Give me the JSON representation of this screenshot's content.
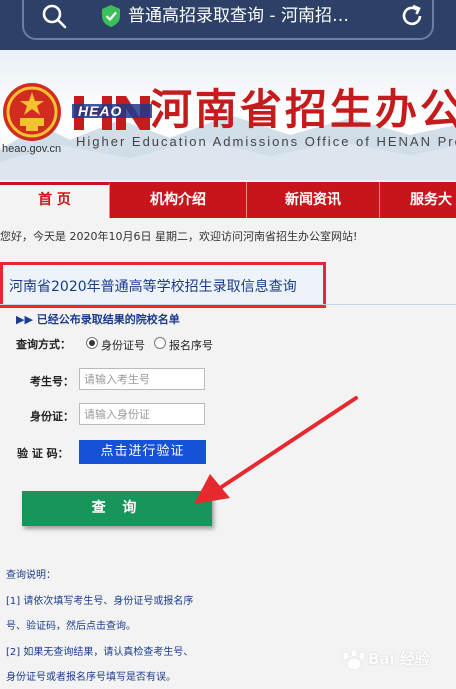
{
  "browser": {
    "url_title": "普通高招录取查询 - 河南招…"
  },
  "header": {
    "logo_mark": "HEAO",
    "domain": "heao.gov.cn",
    "office_name_cn": "河南省招生办公室",
    "office_name_en": "Higher Education Admissions Office of HENAN Prov"
  },
  "nav": {
    "items": [
      {
        "label": "首 页",
        "active": true
      },
      {
        "label": "机构介绍",
        "active": false
      },
      {
        "label": "新闻资讯",
        "active": false
      },
      {
        "label": "服务大",
        "active": false
      }
    ]
  },
  "welcome_text": "您好，今天是 2020年10月6日 星期二，欢迎访问河南省招生办公室网站!",
  "main": {
    "title": "河南省2020年普通高等学校招生录取信息查询",
    "published_link": "▶▶ 已经公布录取结果的院校名单"
  },
  "form": {
    "query_mode_label": "查询方式：",
    "options": [
      {
        "label": "身份证号",
        "checked": true
      },
      {
        "label": "报名序号",
        "checked": false
      }
    ],
    "exam_no_label": "考生号：",
    "exam_no_placeholder": "请输入考生号",
    "id_label": "身份证：",
    "id_placeholder": "请输入身份证",
    "captcha_label": "验 证 码：",
    "verify_button": "点击进行验证",
    "submit_button": "查 询"
  },
  "notes": {
    "heading": "查询说明：",
    "lines": [
      "[1] 请依次填写考生号、身份证号或报名序",
      "号、验证码，然后点击查询。",
      "[2] 如果无查询结果，请认真检查考生号、",
      "身份证号或者报名序号填写是否有误。"
    ]
  },
  "watermark": "Bai 经验",
  "colors": {
    "browser_bar": "#2c4068",
    "nav_red": "#c8151b",
    "highlight_red": "#e5292e",
    "verify_blue": "#1652d8",
    "submit_green": "#18955a",
    "link_blue": "#1b3b8c"
  }
}
